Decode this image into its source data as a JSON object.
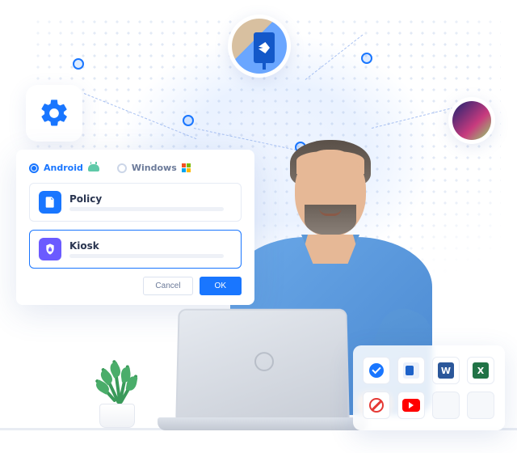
{
  "dialog": {
    "tabs": {
      "android": "Android",
      "windows": "Windows",
      "active": "android"
    },
    "rows": {
      "policy": "Policy",
      "kiosk": "Kiosk",
      "selected": "kiosk"
    },
    "buttons": {
      "cancel": "Cancel",
      "ok": "OK"
    }
  },
  "apps": {
    "word_letter": "W",
    "excel_letter": "X"
  },
  "icons": {
    "gear": "gear-icon",
    "signage": "digital-signage",
    "phone": "mobile-device",
    "check": "allowed-icon",
    "block": "blocked-icon",
    "outlook": "outlook-icon",
    "word": "word-icon",
    "excel": "excel-icon",
    "youtube": "youtube-icon"
  },
  "colors": {
    "primary": "#1976ff",
    "accent": "#6b5bff",
    "allowed": "#1976ff",
    "blocked": "#e53935"
  }
}
